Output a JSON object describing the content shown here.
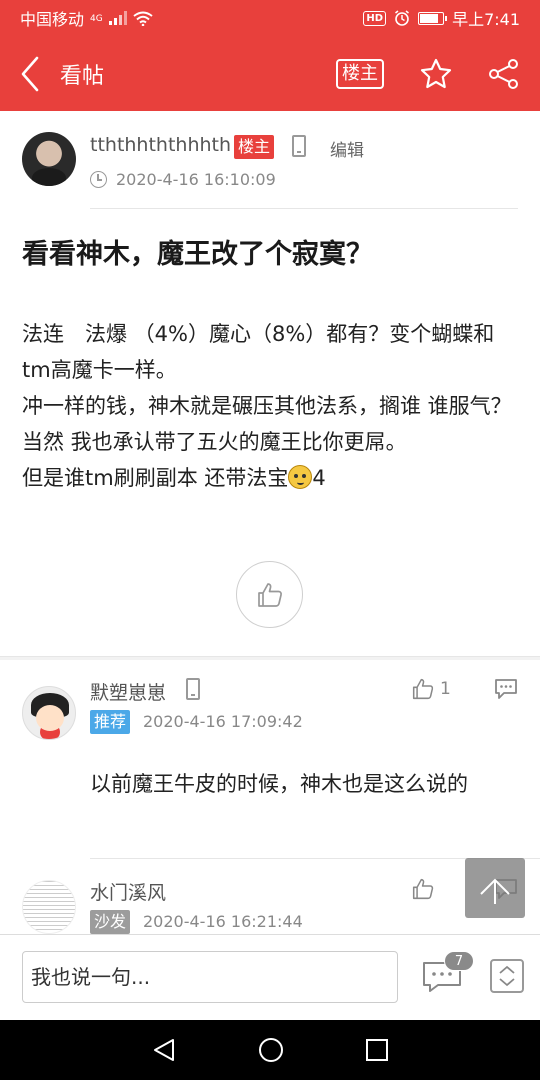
{
  "status_bar": {
    "carrier": "中国移动",
    "network": "4G",
    "hd": "HD",
    "time": "早上7:41",
    "battery_level": 0.85
  },
  "header": {
    "title": "看帖",
    "lz_button": "楼主",
    "icons": [
      "back-arrow-icon",
      "star-icon",
      "share-icon"
    ]
  },
  "post": {
    "author": "tththhththhhth",
    "lz_tag": "楼主",
    "edit_label": "编辑",
    "time": "2020-4-16 16:10:09",
    "title": "看看神木，魔王改了个寂寞？",
    "body": [
      "法连　法爆 （4%）魔心（8%）都有？变个蝴蝶和tm高魔卡一样。",
      "冲一样的钱，神木就是碾压其他法系，搁谁 谁服气？",
      "当然 我也承认带了五火的魔王比你更屌。"
    ],
    "body_last_before_emoji": "但是谁tm刷刷副本 还带法宝",
    "body_last_after_emoji": "4"
  },
  "comments": [
    {
      "name": "默塑崽崽",
      "tag": "推荐",
      "time": "2020-4-16 17:09:42",
      "likes": "1",
      "text": "以前魔王牛皮的时候，神木也是这么说的"
    },
    {
      "name": "水门溪风",
      "tag": "沙发",
      "time": "2020-4-16 16:21:44",
      "likes": "",
      "text": ""
    }
  ],
  "reply_bar": {
    "placeholder": "我也说一句...",
    "comment_count": "7"
  },
  "colors": {
    "brand_red": "#e8403c",
    "tag_blue": "#4ba8e8",
    "tag_gray": "#9c9c9c"
  }
}
